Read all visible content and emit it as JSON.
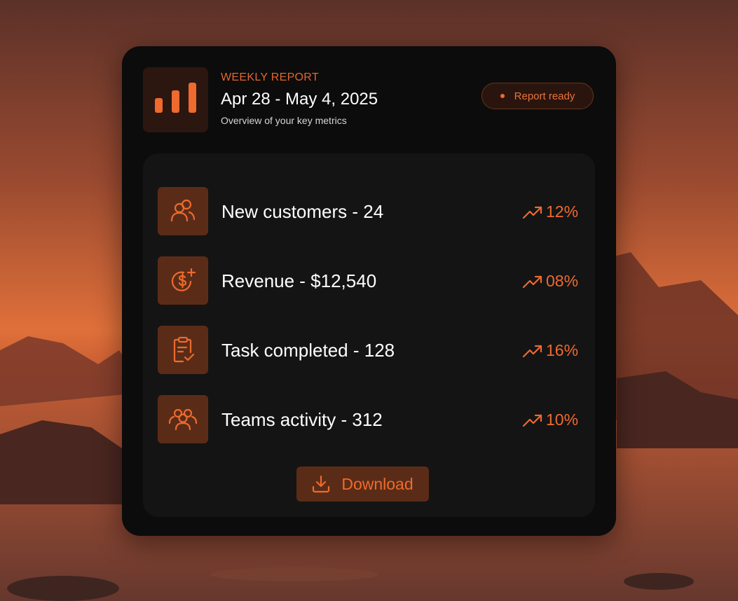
{
  "report": {
    "eyebrow": "WEEKLY REPORT",
    "date_range": "Apr 28 - May 4, 2025",
    "subtitle": "Overview of your key metrics",
    "status": "Report ready",
    "icon": "bar-chart-icon"
  },
  "metrics": [
    {
      "label": "New customers - 24",
      "change": "12%",
      "icon": "users-icon",
      "trend_icon": "trend-up-icon"
    },
    {
      "label": "Revenue - $12,540",
      "change": "08%",
      "icon": "dollar-plus-icon",
      "trend_icon": "trend-up-icon"
    },
    {
      "label": "Task completed - 128",
      "change": "16%",
      "icon": "clipboard-check-icon",
      "trend_icon": "trend-up-icon"
    },
    {
      "label": "Teams activity - 312",
      "change": "10%",
      "icon": "team-icon",
      "trend_icon": "trend-up-icon"
    }
  ],
  "actions": {
    "download_label": "Download",
    "download_icon": "download-icon"
  },
  "colors": {
    "accent": "#ee6a2f",
    "card_bg": "#0c0c0c",
    "inner_bg": "#141414",
    "icon_tile_bg": "#5a2c17"
  }
}
